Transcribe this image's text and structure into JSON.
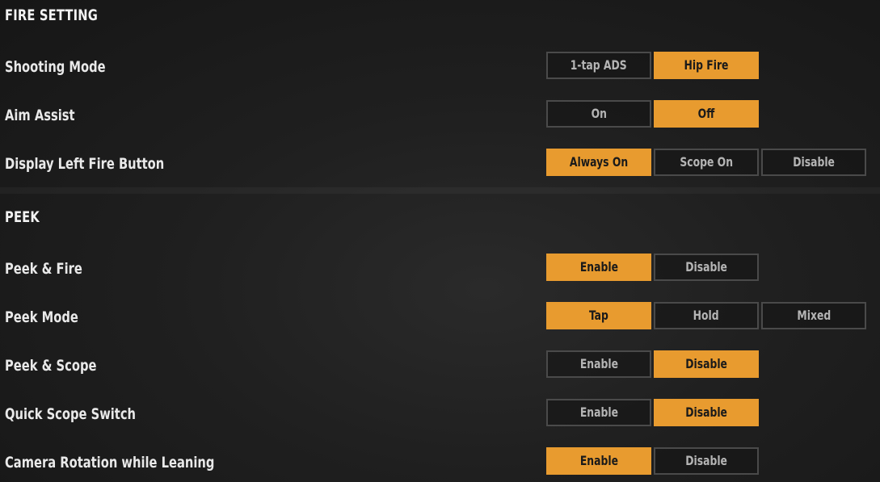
{
  "fire_setting": {
    "title": "FIRE SETTING",
    "rows": [
      {
        "label": "Shooting Mode",
        "options": [
          "1-tap ADS",
          "Hip Fire"
        ],
        "selected": 1
      },
      {
        "label": "Aim Assist",
        "options": [
          "On",
          "Off"
        ],
        "selected": 1
      },
      {
        "label": "Display Left Fire Button",
        "options": [
          "Always On",
          "Scope On",
          "Disable"
        ],
        "selected": 0
      }
    ]
  },
  "peek": {
    "title": "PEEK",
    "rows": [
      {
        "label": "Peek & Fire",
        "options": [
          "Enable",
          "Disable"
        ],
        "selected": 0
      },
      {
        "label": "Peek Mode",
        "options": [
          "Tap",
          "Hold",
          "Mixed"
        ],
        "selected": 0
      },
      {
        "label": "Peek & Scope",
        "options": [
          "Enable",
          "Disable"
        ],
        "selected": 1
      },
      {
        "label": "Quick Scope Switch",
        "options": [
          "Enable",
          "Disable"
        ],
        "selected": 1
      },
      {
        "label": "Camera Rotation while Leaning",
        "options": [
          "Enable",
          "Disable"
        ],
        "selected": 0
      }
    ]
  },
  "colors": {
    "accent": "#e89b2f",
    "background": "#1f1f1f"
  }
}
